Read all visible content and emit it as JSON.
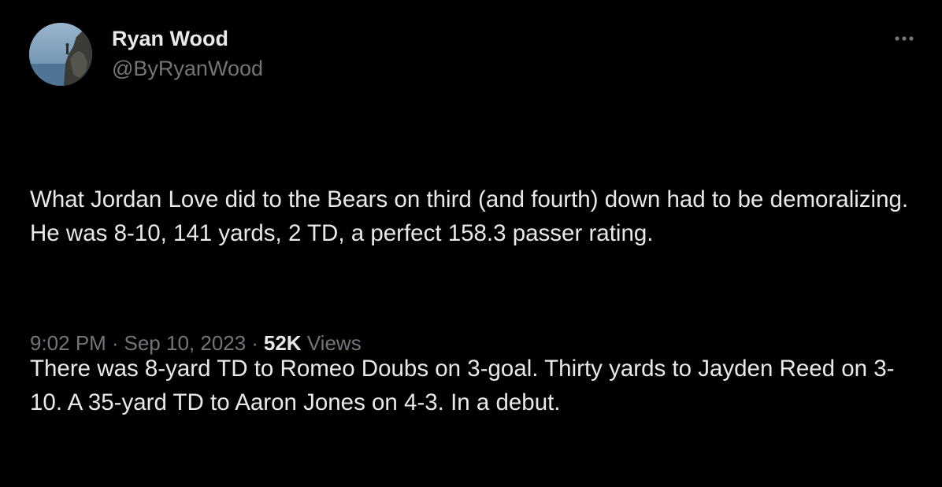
{
  "author": {
    "display_name": "Ryan Wood",
    "handle": "@ByRyanWood"
  },
  "tweet": {
    "paragraphs": [
      "What Jordan Love did to the Bears on third (and fourth) down had to be demoralizing. He was 8-10, 141 yards, 2 TD, a perfect 158.3 passer rating.",
      "There was 8-yard TD to Romeo Doubs on 3-goal. Thirty yards to Jayden Reed on 3-10. A 35-yard TD to Aaron Jones on 4-3. In a debut."
    ]
  },
  "meta": {
    "time": "9:02 PM",
    "separator": "·",
    "date": "Sep 10, 2023",
    "views_count": "52K",
    "views_label": "Views"
  },
  "icons": {
    "more": "more-horizontal-icon",
    "avatar": "avatar-photo"
  },
  "colors": {
    "background": "#000000",
    "primary_text": "#e7e9ea",
    "secondary_text": "#71767b"
  }
}
